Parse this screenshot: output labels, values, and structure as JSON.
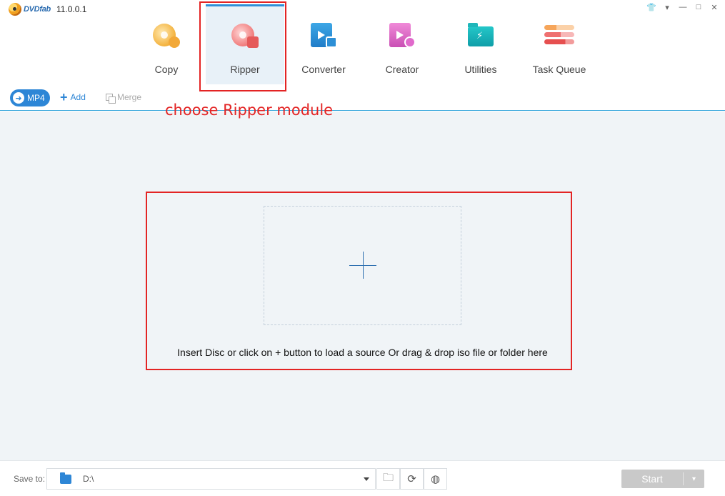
{
  "app": {
    "logo_text": "DVDfab",
    "version": "11.0.0.1"
  },
  "window_controls": {
    "skin": "👕",
    "menu": "▾",
    "minimize": "—",
    "maximize": "□",
    "close": "✕"
  },
  "modules": [
    {
      "label": "Copy",
      "icon": "copy-disc-icon"
    },
    {
      "label": "Ripper",
      "icon": "ripper-disc-icon",
      "active": true
    },
    {
      "label": "Converter",
      "icon": "converter-film-icon"
    },
    {
      "label": "Creator",
      "icon": "creator-film-icon"
    },
    {
      "label": "Utilities",
      "icon": "utilities-folder-icon"
    },
    {
      "label": "Task Queue",
      "icon": "task-queue-icon"
    }
  ],
  "toolbar": {
    "profile_label": "MP4",
    "add_label": "Add",
    "merge_label": "Merge"
  },
  "main": {
    "hint": "Insert Disc or click on + button to load a source Or drag & drop iso file or folder here"
  },
  "annotation": {
    "text": "choose Ripper module",
    "color": "#e32424"
  },
  "bottom": {
    "save_to_label": "Save to:",
    "path": "D:\\",
    "start_label": "Start"
  },
  "colors": {
    "accent": "#2d86d6",
    "main_bg": "#f0f4f7",
    "start_disabled": "#c9c9c9"
  }
}
